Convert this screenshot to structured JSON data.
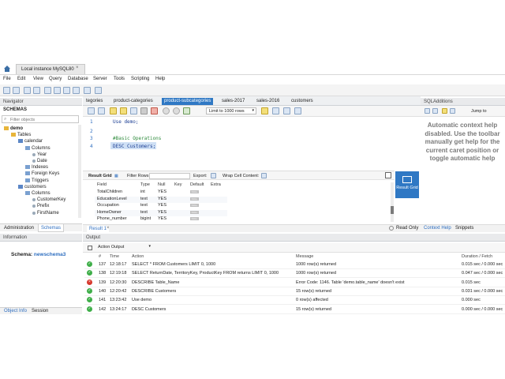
{
  "window": {
    "connection_tab": "Local instance MySQL80",
    "close": "×"
  },
  "menu": [
    "File",
    "Edit",
    "View",
    "Query",
    "Database",
    "Server",
    "Tools",
    "Scripting",
    "Help"
  ],
  "navigator": {
    "title": "Navigator",
    "schemas_label": "SCHEMAS",
    "filter_placeholder": "Filter objects",
    "tree": [
      {
        "label": "demo",
        "indent": 0
      },
      {
        "label": "Tables",
        "indent": 1
      },
      {
        "label": "calendar",
        "indent": 2
      },
      {
        "label": "Columns",
        "indent": 3
      },
      {
        "label": "Year",
        "indent": 4
      },
      {
        "label": "Date",
        "indent": 4
      },
      {
        "label": "Indexes",
        "indent": 3
      },
      {
        "label": "Foreign Keys",
        "indent": 3
      },
      {
        "label": "Triggers",
        "indent": 3
      },
      {
        "label": "customers",
        "indent": 2
      },
      {
        "label": "Columns",
        "indent": 3
      },
      {
        "label": "CustomerKey",
        "indent": 4
      },
      {
        "label": "Prefix",
        "indent": 4
      },
      {
        "label": "FirstName",
        "indent": 4
      }
    ],
    "tab_admin": "Administration",
    "tab_schemas": "Schemas",
    "info_title": "Information",
    "schema_label": "Schema:",
    "schema_value": "newschema3",
    "tab_object_info": "Object Info",
    "tab_session": "Session"
  },
  "editor": {
    "tabs": [
      "tegories",
      "product-categories",
      "product-subcategories",
      "sales-2017",
      "sales-2016",
      "customers"
    ],
    "active_tab": 2,
    "limit_label": "Limit to 1000 rows",
    "lines": [
      {
        "no": "1",
        "code": "Use demo;"
      },
      {
        "no": "2",
        "code": ""
      },
      {
        "no": "3",
        "code": "#Basic Operations"
      },
      {
        "no": "4",
        "code": "DESC Customers;"
      }
    ]
  },
  "result": {
    "grid_label": "Result Grid",
    "filter_label": "Filter Rows:",
    "export_label": "Export:",
    "wrap_label": "Wrap Cell Content:",
    "columns": [
      "Field",
      "Type",
      "Null",
      "Key",
      "Default",
      "Extra"
    ],
    "rows": [
      [
        "TotalChildren",
        "int",
        "YES",
        "",
        "NULL",
        ""
      ],
      [
        "EducationLevel",
        "text",
        "YES",
        "",
        "NULL",
        ""
      ],
      [
        "Occupation",
        "text",
        "YES",
        "",
        "NULL",
        ""
      ],
      [
        "HomeOwner",
        "text",
        "YES",
        "",
        "NULL",
        ""
      ],
      [
        "Phone_number",
        "bigint",
        "YES",
        "",
        "NULL",
        ""
      ]
    ],
    "result_tab": "Result 1",
    "read_only": "Read Only",
    "side_button": "Result Grid"
  },
  "sql_additions": {
    "title": "SQLAdditions",
    "jump_to": "Jump to",
    "context_lines": [
      "Automatic context help",
      "disabled. Use the toolbar",
      "manually get help for the",
      "current caret position or",
      "toggle automatic help"
    ],
    "tab_context": "Context Help",
    "tab_snippets": "Snippets"
  },
  "output": {
    "title": "Output",
    "mode": "Action Output",
    "columns": [
      "#",
      "Time",
      "Action",
      "Message",
      "Duration / Fetch"
    ],
    "rows": [
      {
        "status": "ok",
        "n": "137",
        "time": "12:18:17",
        "action": "SELECT * FROM Customers LIMIT 0, 1000",
        "message": "1000 row(s) returned",
        "duration": "0.015 sec / 0.000 sec"
      },
      {
        "status": "ok",
        "n": "138",
        "time": "12:19:18",
        "action": "SELECT ReturnDate, TerritoryKey, ProductKey FROM returns LIMIT 0, 1000",
        "message": "1000 row(s) returned",
        "duration": "0.047 sec / 0.000 sec"
      },
      {
        "status": "err",
        "n": "139",
        "time": "12:20:30",
        "action": "DESCRIBE Table_Name",
        "message": "Error Code: 1146. Table 'demo.table_name' doesn't exist",
        "duration": "0.015 sec"
      },
      {
        "status": "ok",
        "n": "140",
        "time": "12:20:42",
        "action": "DESCRIBE Customers",
        "message": "15 row(s) returned",
        "duration": "0.031 sec / 0.000 sec"
      },
      {
        "status": "ok",
        "n": "141",
        "time": "13:23:42",
        "action": "Use demo",
        "message": "0 row(s) affected",
        "duration": "0.000 sec"
      },
      {
        "status": "ok",
        "n": "142",
        "time": "13:24:17",
        "action": "DESC Customers",
        "message": "15 row(s) returned",
        "duration": "0.000 sec / 0.000 sec"
      }
    ]
  },
  "colors": {
    "accent": "#2f78c4",
    "ok": "#3fae49",
    "error": "#d6372c",
    "highlight": "#cfe0f5"
  }
}
